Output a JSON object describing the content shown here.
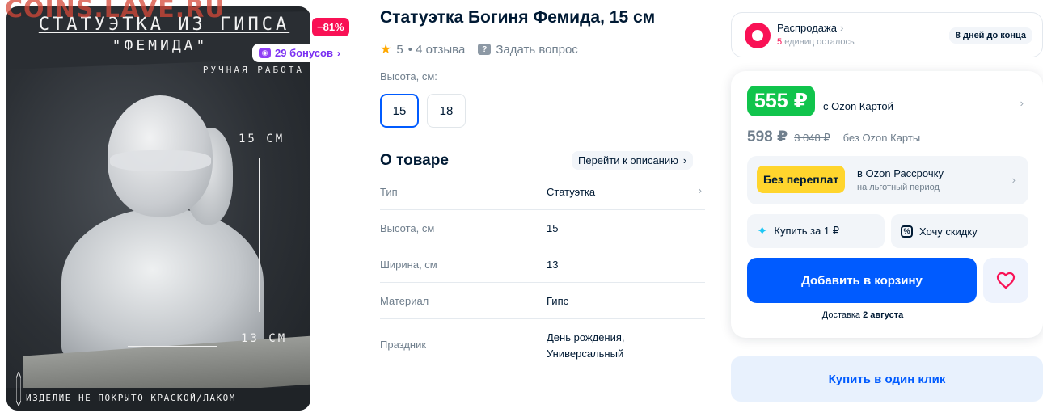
{
  "watermark": "COINS.LAVE.RU",
  "image": {
    "title": "СТАТУЭТКА ИЗ ГИПСА",
    "subtitle": "\"ФЕМИДА\"",
    "handmade": "РУЧНАЯ РАБОТА",
    "height_caption": "15 СМ",
    "width_caption": "13 СМ",
    "note": "ИЗДЕЛИЕ НЕ ПОКРЫТО КРАСКОЙ/ЛАКОМ"
  },
  "discount_badge": "−81%",
  "bonus_badge": "29 бонусов",
  "product": {
    "name": "Статуэтка Богиня Фемида, 15 см",
    "rating": "5",
    "reviews": "• 4 отзыва",
    "ask_question": "Задать вопрос"
  },
  "variants": {
    "label": "Высота, см:",
    "options": [
      "15",
      "18"
    ],
    "selected": "15"
  },
  "about": {
    "title": "О товаре",
    "goto_description": "Перейти к описанию",
    "specs": [
      {
        "key": "Тип",
        "value": "Статуэтка"
      },
      {
        "key": "Высота, см",
        "value": "15"
      },
      {
        "key": "Ширина, см",
        "value": "13"
      },
      {
        "key": "Материал",
        "value": "Гипс"
      },
      {
        "key": "Праздник",
        "value_line1": "День рождения,",
        "value_line2": "Универсальный"
      }
    ]
  },
  "sale": {
    "title": "Распродажа",
    "units_left_count": "5",
    "units_left_text": "единиц осталось",
    "days_left": "8 дней до конца"
  },
  "price": {
    "card_price": "555 ₽",
    "card_note": "с Ozon Картой",
    "regular_price": "598 ₽",
    "old_price": "3 048 ₽",
    "no_card_note": "без Ozon Карты"
  },
  "installment": {
    "badge": "Без переплат",
    "title": "в Ozon Рассрочку",
    "subtitle": "на льготный период"
  },
  "actions": {
    "buy_for_one": "Купить за 1 ₽",
    "want_discount": "Хочу скидку",
    "add_to_cart": "Добавить в корзину",
    "buy_one_click": "Купить в один клик"
  },
  "delivery": {
    "prefix": "Доставка",
    "date": "2 августа"
  },
  "colors": {
    "brand_blue": "#005bff",
    "price_green": "#10c44c",
    "sale_pink": "#f91155",
    "bonus_purple": "#7a2ff2",
    "installment_yellow": "#ffd52d"
  }
}
